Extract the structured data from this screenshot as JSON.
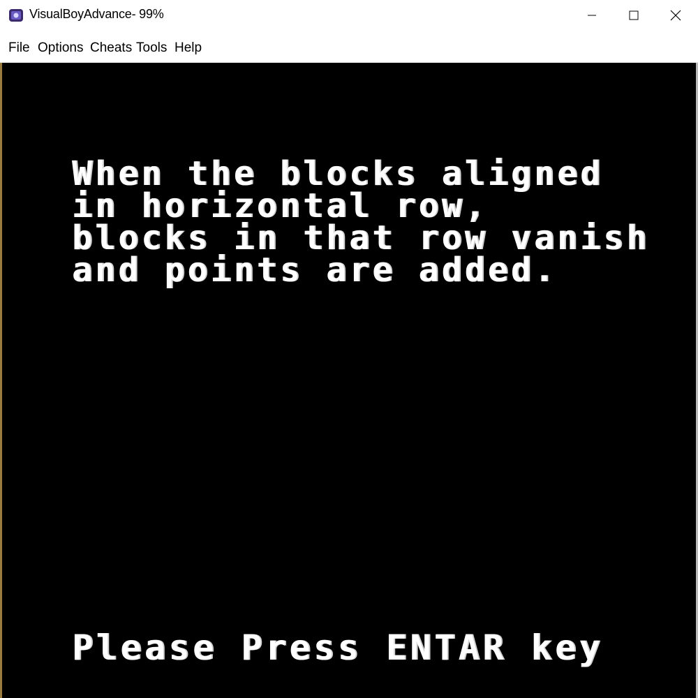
{
  "window": {
    "title": "VisualBoyAdvance- 99%",
    "icon": "vba-app-icon",
    "controls": {
      "minimize_icon": "minimize-icon",
      "maximize_icon": "maximize-icon",
      "close_icon": "close-icon"
    }
  },
  "menubar": {
    "items": [
      {
        "label": "File"
      },
      {
        "label": "Options"
      },
      {
        "label": "Cheats"
      },
      {
        "label": "Tools"
      },
      {
        "label": "Help"
      }
    ]
  },
  "game": {
    "message_lines": [
      "When the blocks aligned",
      "in horizontal row,",
      "blocks in that row vanish",
      "and points are added."
    ],
    "prompt": "Please Press ENTAR key"
  },
  "colors": {
    "screen_background": "#000000",
    "text": "#ffffff",
    "chrome": "#ffffff"
  }
}
